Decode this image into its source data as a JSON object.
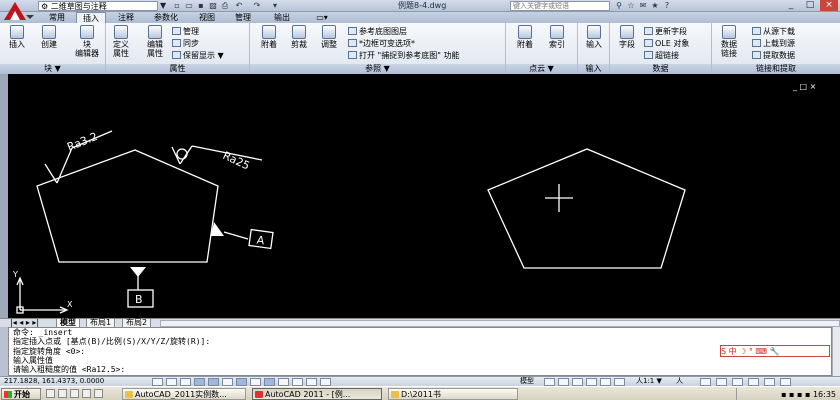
{
  "titlebar": {
    "workspace": "二维草图与注释",
    "file_title": "例题8-4.dwg",
    "search_placeholder": "键入关键字或短语",
    "min": "_",
    "max": "□",
    "close": "×",
    "quick_arrow": "▼"
  },
  "tabs": [
    "常用",
    "插入",
    "注释",
    "参数化",
    "视图",
    "管理",
    "输出"
  ],
  "ribbon": {
    "block_panel": {
      "title": "块 ▼",
      "insert": "插入",
      "create": "创建",
      "block_editor": "块\n编辑器"
    },
    "attr_panel": {
      "title": "属性",
      "define": "定义\n属性",
      "edit": "编辑\n属性",
      "manage": "管理",
      "sync": "同步",
      "keep_display": "保留显示 ▼"
    },
    "ref_panel": {
      "title": "参照 ▼",
      "attach": "附着",
      "clip": "剪裁",
      "adjust": "调整",
      "underlay_layers": "参考底图图层",
      "frame_variable": "*边框可变选项*",
      "snap_underlay": "打开 \"捕捉到参考底图\" 功能"
    },
    "pointcloud_panel": {
      "title": "点云 ▼",
      "attach": "附着",
      "index": "索引"
    },
    "import_panel": {
      "title": "输入",
      "import": "输入"
    },
    "data_panel": {
      "title": "数据",
      "field": "字段",
      "update_fields": "更新字段",
      "ole_object": "OLE 对象",
      "hyperlink": "超链接"
    },
    "link_panel": {
      "title": "链接和提取",
      "data_link": "数据\n链接",
      "download_source": "从源下载",
      "upload_source": "上载到源",
      "extract_data": "提取数据"
    }
  },
  "drawing": {
    "labels": {
      "ra32": "Ra3.2",
      "ra25": "Ra25",
      "datum_a": "A",
      "datum_b": "B",
      "axis_x": "X",
      "axis_y": "Y"
    },
    "window_buttons": "_ □ ×"
  },
  "layout_tabs": {
    "nav": "|◂ ◂ ▸ ▸|",
    "model": "模型",
    "layout1": "布局1",
    "layout2": "布局2"
  },
  "command_lines": [
    "命令: _insert",
    "指定插入点或 [基点(B)/比例(S)/X/Y/Z/旋转(R)]:",
    "指定旋转角度 <0>:",
    "输入属性值",
    "请输入粗糙度的值 <Ra12.5>:"
  ],
  "ime_text": "S 中 ☽ ° ⌨ 🔧",
  "status": {
    "coords": "217.1828, 161.4373, 0.0000",
    "model": "模型",
    "scale": "人1:1 ▼",
    "annotation": "人"
  },
  "taskbar": {
    "start": "开始",
    "tasks": [
      "AutoCAD_2011实例数...",
      "AutoCAD 2011 - [例...",
      "D:\\2011书"
    ],
    "clock": "16:35"
  }
}
